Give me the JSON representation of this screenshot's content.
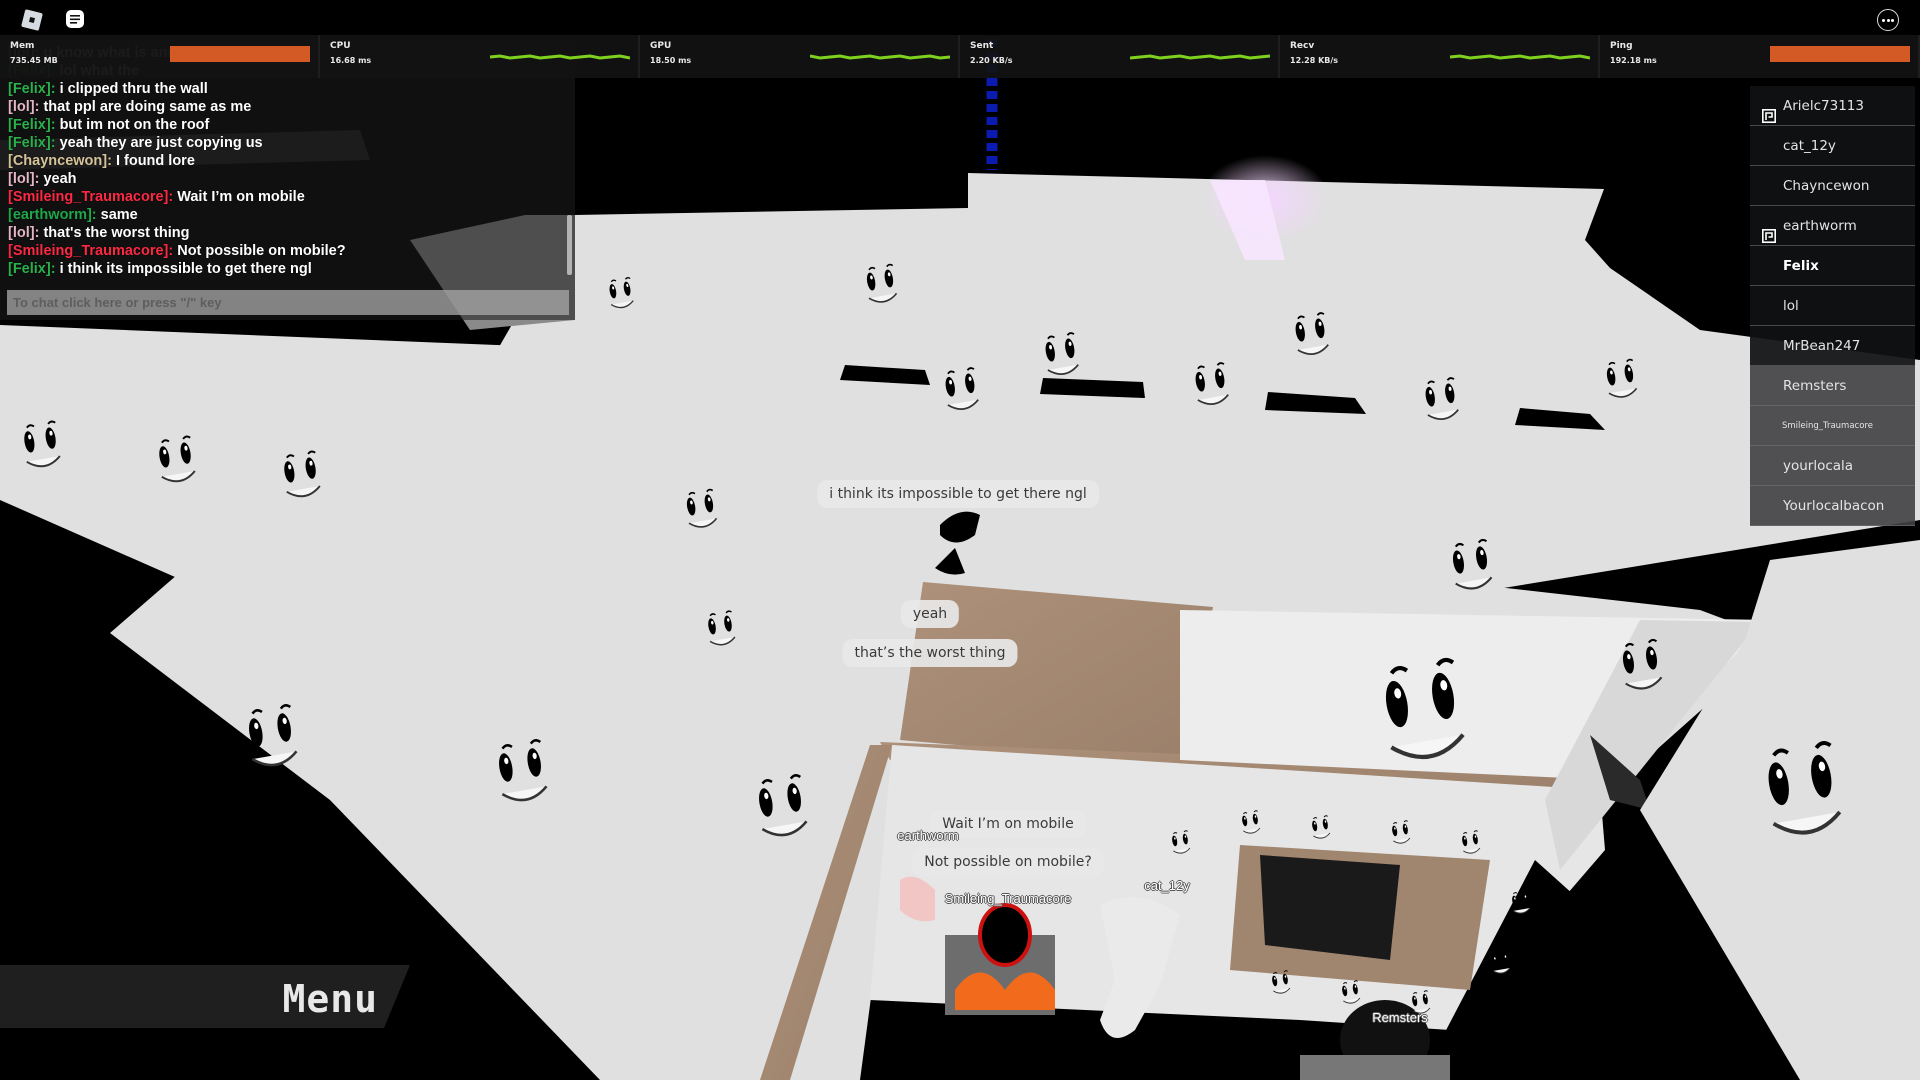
{
  "topbar": {
    "roblox_menu_icon": "roblox-logo-icon",
    "chat_toggle_icon": "chat-bubble-icon",
    "more_icon": "more-options-icon"
  },
  "stats": [
    {
      "label": "Mem",
      "value": "735.45 MB",
      "graph": "bar",
      "bar_color": "#d35a24"
    },
    {
      "label": "CPU",
      "value": "16.68 ms",
      "graph": "line",
      "line_color": "#7fd11f"
    },
    {
      "label": "GPU",
      "value": "18.50 ms",
      "graph": "line",
      "line_color": "#7fd11f"
    },
    {
      "label": "Sent",
      "value": "2.20 KB/s",
      "graph": "line",
      "line_color": "#7fd11f"
    },
    {
      "label": "Recv",
      "value": "12.28 KB/s",
      "graph": "line",
      "line_color": "#7fd11f"
    },
    {
      "label": "Ping",
      "value": "192.18 ms",
      "graph": "bar",
      "bar_color": "#d35a24"
    }
  ],
  "chat": {
    "messages": [
      {
        "user": "[lol]:",
        "text": "u know what is ann",
        "color": "#e3b5c5",
        "faded": true
      },
      {
        "user": "[Felix]:",
        "text": "lol what the",
        "color": "#2bb14c",
        "faded": true
      },
      {
        "user": "[Felix]:",
        "text": "i clipped thru the wall",
        "color": "#2bb14c"
      },
      {
        "user": "[lol]:",
        "text": "that ppl are doing same as me",
        "color": "#e3b5c5"
      },
      {
        "user": "[Felix]:",
        "text": "but im not on the roof",
        "color": "#2bb14c"
      },
      {
        "user": "[Felix]:",
        "text": "yeah they are just copying us",
        "color": "#2bb14c"
      },
      {
        "user": "[Chayncewon]:",
        "text": "I found lore",
        "color": "#d7c59a"
      },
      {
        "user": "[lol]:",
        "text": "yeah",
        "color": "#e3b5c5"
      },
      {
        "user": "[Smileing_Traumacore]:",
        "text": "Wait I’m on mobile",
        "color": "#fd2943"
      },
      {
        "user": "[earthworm]:",
        "text": "same",
        "color": "#1fa84a"
      },
      {
        "user": "[lol]:",
        "text": "that's the worst thing",
        "color": "#e3b5c5"
      },
      {
        "user": "[Smileing_Traumacore]:",
        "text": "Not possible on mobile?",
        "color": "#fd2943"
      },
      {
        "user": "[Felix]:",
        "text": "i think its impossible to get there ngl",
        "color": "#2bb14c"
      }
    ],
    "input_placeholder": "To chat click here or press \"/\" key"
  },
  "player_list": [
    {
      "name": "Arielc73113",
      "premium": true,
      "style": "dark"
    },
    {
      "name": "cat_12y",
      "premium": false,
      "style": "dark"
    },
    {
      "name": "Chayncewon",
      "premium": false,
      "style": "dark"
    },
    {
      "name": "earthworm",
      "premium": true,
      "style": "dark"
    },
    {
      "name": "Felix",
      "premium": false,
      "style": "dark",
      "local": true
    },
    {
      "name": "lol",
      "premium": false,
      "style": "dark"
    },
    {
      "name": "MrBean247",
      "premium": false,
      "style": "dark"
    },
    {
      "name": "Remsters",
      "premium": false,
      "style": "grey"
    },
    {
      "name": "Smileing_Traumacore",
      "premium": false,
      "style": "grey",
      "small": true
    },
    {
      "name": "yourlocala",
      "premium": false,
      "style": "grey"
    },
    {
      "name": "Yourlocalbacon",
      "premium": false,
      "style": "grey"
    }
  ],
  "bubbles": {
    "felix": "i think its impossible to get there ngl",
    "lol_1": "yeah",
    "lol_2": "that’s the worst thing",
    "smileing_1": "Wait I’m on mobile",
    "smileing_2": "Not possible on mobile?"
  },
  "nametags": {
    "earthworm": "earthworm",
    "smileing": "Smileing_Traumacore",
    "cat": "cat_12y",
    "remsters": "Remsters"
  },
  "menu": {
    "label": "Menu"
  },
  "colors": {
    "wall": "#e0e0e0",
    "wood": "#a58a74",
    "glow": "#f4d6ff",
    "stat_warning": "#d35a24",
    "stat_ok": "#7fd11f"
  }
}
